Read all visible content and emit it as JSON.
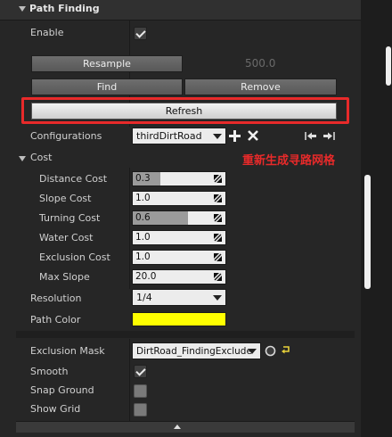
{
  "section": {
    "title": "Path Finding"
  },
  "enable": {
    "label": "Enable",
    "checked": true
  },
  "resample": {
    "label": "Resample",
    "value": "500.0"
  },
  "find_label": "Find",
  "remove_label": "Remove",
  "refresh_label": "Refresh",
  "configurations": {
    "label": "Configurations",
    "selected": "thirdDirtRoad"
  },
  "annotation": "重新生成寻路网格",
  "cost": {
    "title": "Cost",
    "rows": [
      {
        "label": "Distance Cost",
        "value": "0.3",
        "level": 0.3
      },
      {
        "label": "Slope Cost",
        "value": "1.0",
        "level": 0.0
      },
      {
        "label": "Turning Cost",
        "value": "0.6",
        "level": 0.6
      },
      {
        "label": "Water Cost",
        "value": "1.0",
        "level": 0.0
      },
      {
        "label": "Exclusion Cost",
        "value": "1.0",
        "level": 0.0
      },
      {
        "label": "Max Slope",
        "value": "20.0",
        "level": 0.0
      }
    ]
  },
  "resolution": {
    "label": "Resolution",
    "selected": "1/4"
  },
  "path_color": {
    "label": "Path Color",
    "color": "#ffff00"
  },
  "exclusion_mask": {
    "label": "Exclusion Mask",
    "selected": "DirtRoad_FindingExclude"
  },
  "smooth": {
    "label": "Smooth",
    "checked": true
  },
  "snap_ground": {
    "label": "Snap Ground",
    "checked": false
  },
  "show_grid": {
    "label": "Show Grid",
    "checked": false
  },
  "colors": {
    "accent_red": "#e82a2a",
    "panel": "#262626"
  }
}
